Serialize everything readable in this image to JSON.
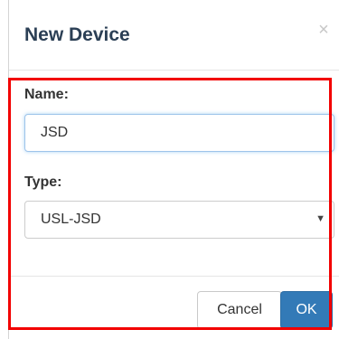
{
  "dialog": {
    "title": "New Device",
    "close_symbol": "×"
  },
  "form": {
    "name": {
      "label": "Name:",
      "value": "JSD"
    },
    "type": {
      "label": "Type:",
      "selected": "USL-JSD",
      "chevron": "▼"
    }
  },
  "footer": {
    "cancel_label": "Cancel",
    "ok_label": "OK"
  },
  "colors": {
    "title": "#2b3f55",
    "highlight_border": "#f20000",
    "primary_button": "#337ab7"
  }
}
